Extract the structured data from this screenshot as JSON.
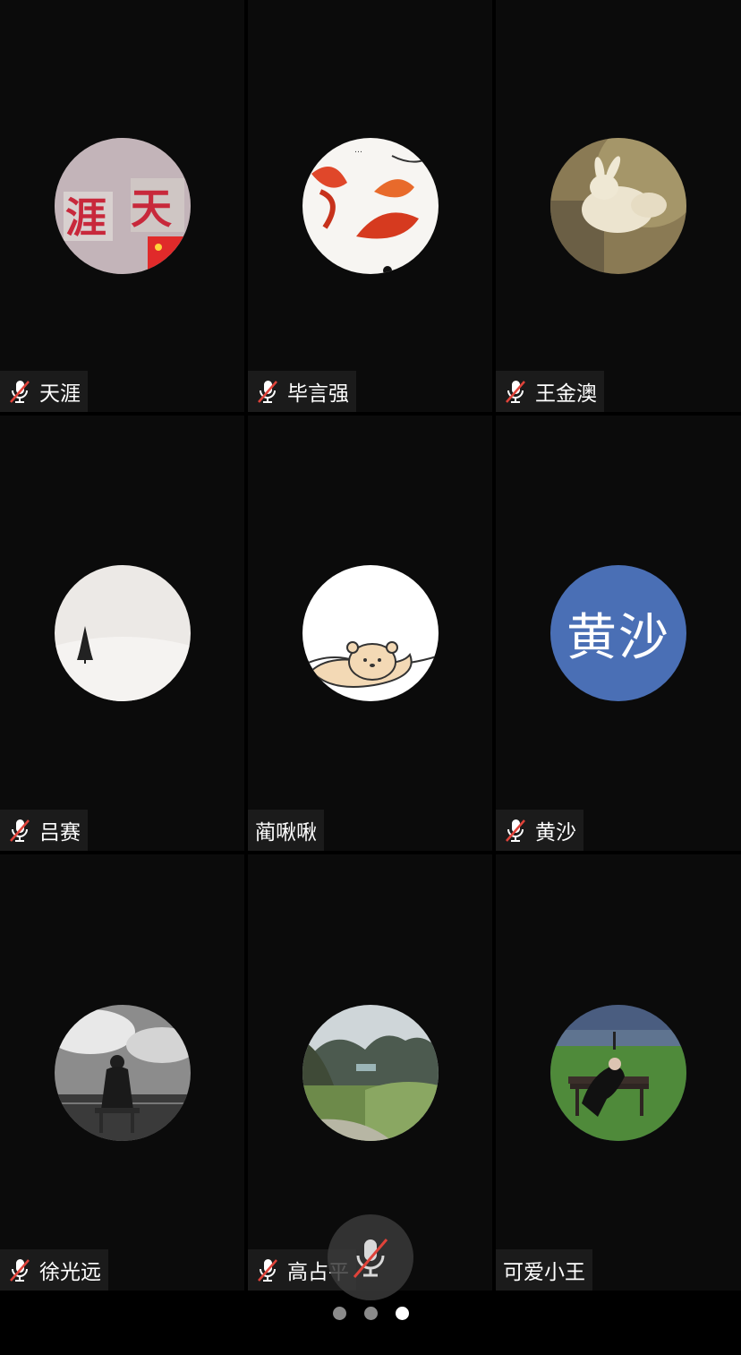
{
  "participants": [
    {
      "name": "天涯",
      "muted": true,
      "avatar": "photo-chinese-characters"
    },
    {
      "name": "毕言强",
      "muted": true,
      "avatar": "photo-koi-painting"
    },
    {
      "name": "王金澳",
      "muted": true,
      "avatar": "photo-rabbit"
    },
    {
      "name": "吕赛",
      "muted": true,
      "avatar": "photo-lone-tree-snow"
    },
    {
      "name": "蔺啾啾",
      "muted": false,
      "avatar": "illustration-bear"
    },
    {
      "name": "黄沙",
      "muted": true,
      "avatar": "text-initials",
      "initials": "黄沙",
      "avatar_color": "#4a6fb5"
    },
    {
      "name": "徐光远",
      "muted": true,
      "avatar": "photo-person-bw"
    },
    {
      "name": "高占平",
      "muted": true,
      "avatar": "photo-mountains"
    },
    {
      "name": "可爱小王",
      "muted": false,
      "avatar": "photo-person-on-bench"
    }
  ],
  "controls": {
    "mic_button": {
      "state": "muted",
      "icon": "mic-off-icon"
    }
  },
  "pager": {
    "page_count": 3,
    "active_page": 3
  },
  "colors": {
    "tile_background": "#0b0b0b",
    "mute_slash": "#e0433a",
    "accent_avatar": "#4a6fb5"
  }
}
